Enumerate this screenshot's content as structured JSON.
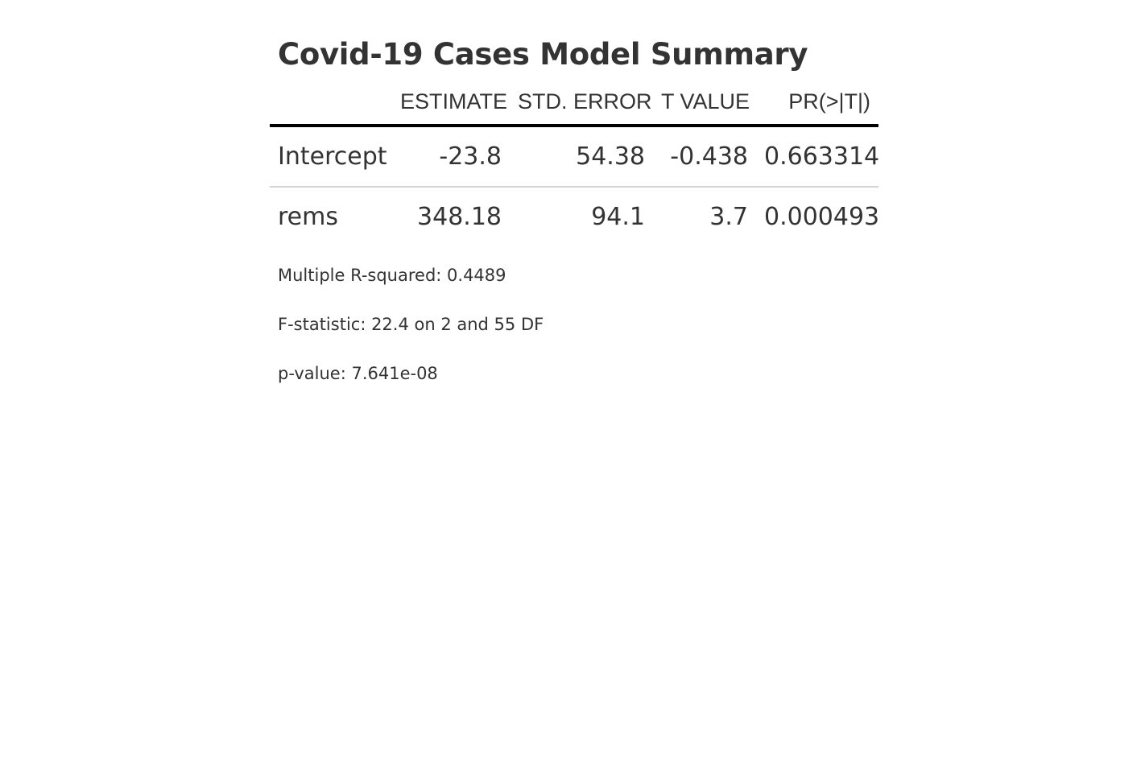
{
  "chart_data": {
    "type": "table",
    "title": "Covid-19 Cases Model Summary",
    "columns": [
      "",
      "ESTIMATE",
      "STD. ERROR",
      "T VALUE",
      "PR(>|T|)"
    ],
    "rows": [
      {
        "term": "Intercept",
        "estimate": "-23.8",
        "std_error": "54.38",
        "t_value": "-0.438",
        "p_value": "0.663314"
      },
      {
        "term": "rems",
        "estimate": "348.18",
        "std_error": "94.1",
        "t_value": "3.7",
        "p_value": "0.000493"
      }
    ],
    "notes": [
      "Multiple R-squared: 0.4489",
      "F-statistic: 22.4 on 2 and 55 DF",
      "p-value: 7.641e-08"
    ]
  }
}
